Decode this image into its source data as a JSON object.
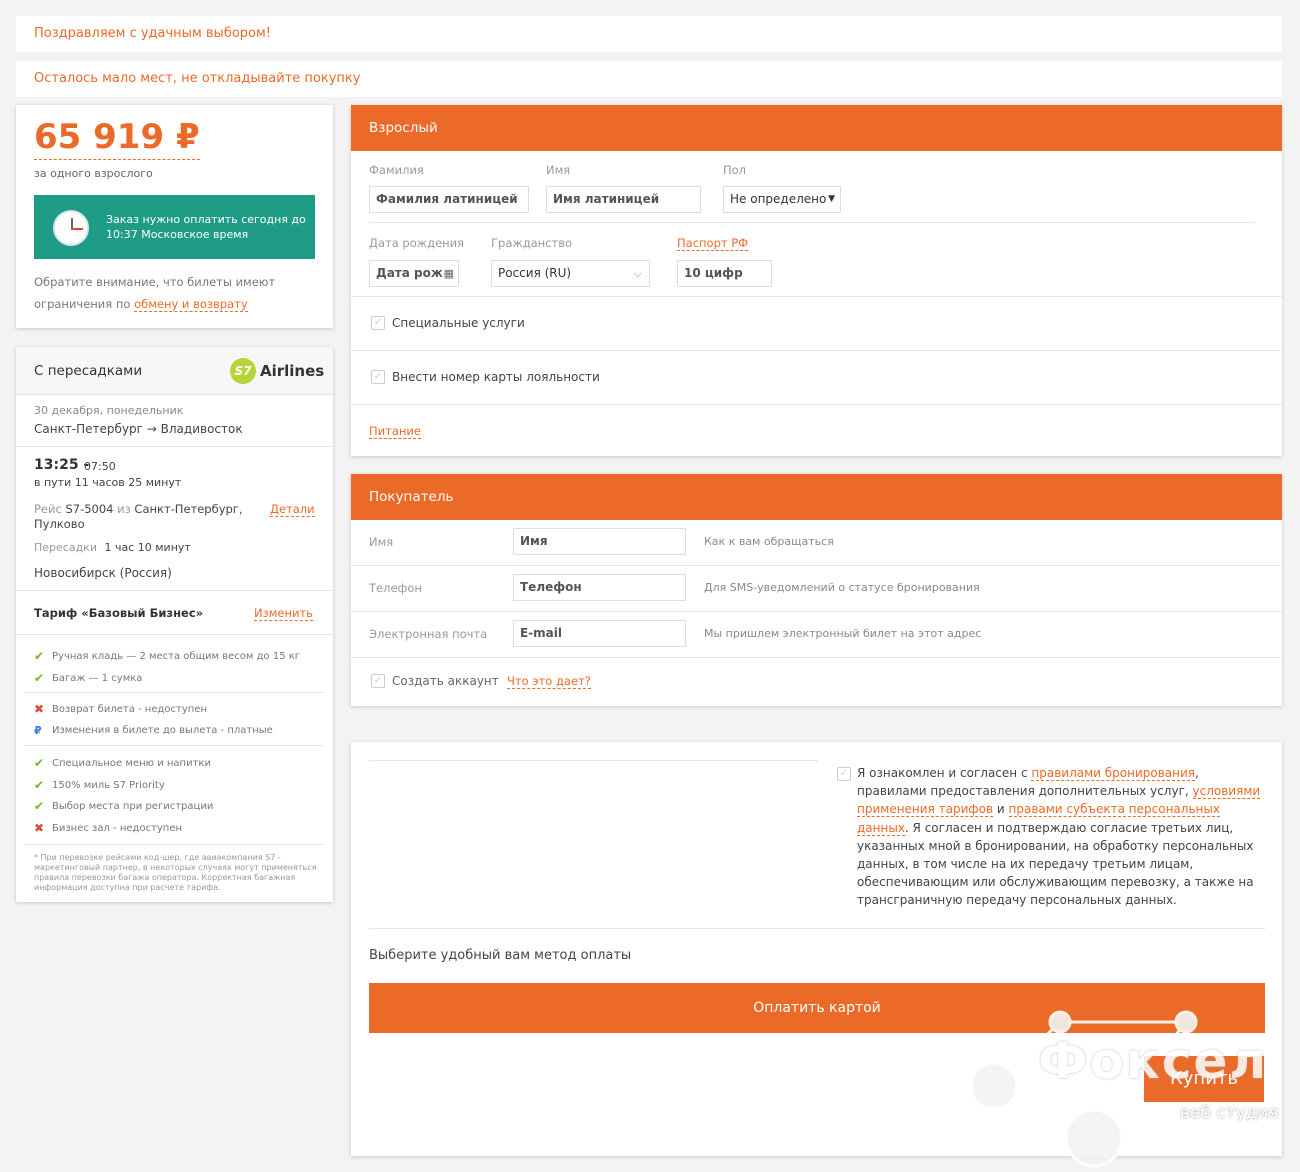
{
  "notices": [
    "Поздравляем с удачным выбором!",
    "Осталось мало мест, не откладывайте покупку"
  ],
  "price_card": {
    "price": "65 919 ₽",
    "price_sub": "за одного взрослого",
    "pay_deadline": "Заказ нужно оплатить сегодня до 10:37 Московское время",
    "note_text": "Обратите внимание, что билеты имеют ограничения по",
    "note_link": "обмену и возврату"
  },
  "flight_card": {
    "header": "С пересадками",
    "airline_logo": "S7",
    "airline_name": "Airlines",
    "date": "30 декабря, понедельник",
    "route": "Санкт-Петербург → Владивосток",
    "depart": "13:25 -",
    "arrive": "07:50",
    "duration": "в пути 11 часов 25 минут",
    "flight_prefix": "Рейс",
    "flight_number": "S7-5004",
    "flight_from_word": "из",
    "flight_from": "Санкт-Петербург, Пулково",
    "details_link": "Детали",
    "transfer_label": "Пересадки",
    "transfer_time": "1 час 10 минут",
    "transfer_city": "Новосибирск (Россия)",
    "tariff": "Тариф «Базовый Бизнес»",
    "change_link": "Изменить",
    "features": [
      {
        "icon": "check",
        "text": "Ручная кладь — 2 места общим весом до 15 кг"
      },
      {
        "icon": "check",
        "text": "Багаж — 1 сумка"
      },
      {
        "icon": "cross",
        "text": "Возврат билета - недоступен"
      },
      {
        "icon": "ruble",
        "text": "Изменения в билете до вылета - платные"
      },
      {
        "icon": "check",
        "text": "Специальное меню и напитки"
      },
      {
        "icon": "check",
        "text": "150% миль S7 Priority"
      },
      {
        "icon": "check",
        "text": "Выбор места при регистрации"
      },
      {
        "icon": "cross",
        "text": "Бизнес зал - недоступен"
      }
    ],
    "footnote": "* При перевозке рейсами код-шер, где авиакомпания S7 - маркетинговый партнер, в некоторых случаях могут применяться правила перевозки багажа оператора. Корректная багажная информация доступна при расчете тарифа."
  },
  "adult_form": {
    "title": "Взрослый",
    "surname_label": "Фамилия",
    "surname_placeholder": "Фамилия латиницей",
    "name_label": "Имя",
    "name_placeholder": "Имя латиницей",
    "gender_label": "Пол",
    "gender_value": "Не определено",
    "birth_label": "Дата рождения",
    "birth_placeholder": "Дата рожд",
    "citizenship_label": "Гражданство",
    "citizenship_value": "Россия (RU)",
    "passport_link": "Паспорт РФ",
    "passport_placeholder": "10 цифр",
    "special_services": "Специальные услуги",
    "loyalty": "Внести номер карты лояльности",
    "meal_link": "Питание"
  },
  "buyer_form": {
    "title": "Покупатель",
    "rows": [
      {
        "label": "Имя",
        "placeholder": "Имя",
        "hint": "Как к вам обращаться"
      },
      {
        "label": "Телефон",
        "placeholder": "Телефон",
        "hint": "Для SMS-уведомлений о статусе бронирования"
      },
      {
        "label": "Электронная почта",
        "placeholder": "E-mail",
        "hint": "Мы пришлем электронный билет на этот адрес"
      }
    ],
    "create_account": "Создать аккаунт",
    "what_link": "Что это дает?"
  },
  "payment": {
    "agree_1": "Я ознакомлен и согласен с",
    "agree_link1": "правилами бронирования",
    "agree_2": ", правилами предоставления дополнительных услуг,",
    "agree_link2": "условиями применения тарифов",
    "agree_3": "и",
    "agree_link3": "правами субъекта персональных данных",
    "agree_4": ". Я согласен и подтверждаю согласие третьих лиц, указанных мной в бронировании, на обработку персональных данных, в том числе на их передачу третьим лицам, обеспечивающим или обслуживающим перевозку, а также на трансграничную передачу персональных данных.",
    "method_title": "Выберите удобный вам метод оплаты",
    "card_button": "Оплатить картой",
    "buy_button": "Купить"
  },
  "watermark": {
    "title": "Фоксел",
    "subtitle": "веб студия"
  },
  "colors": {
    "accent": "#ec6a27",
    "teal": "#1e9c86",
    "check": "#6fb62d",
    "cross": "#e04b3b"
  }
}
